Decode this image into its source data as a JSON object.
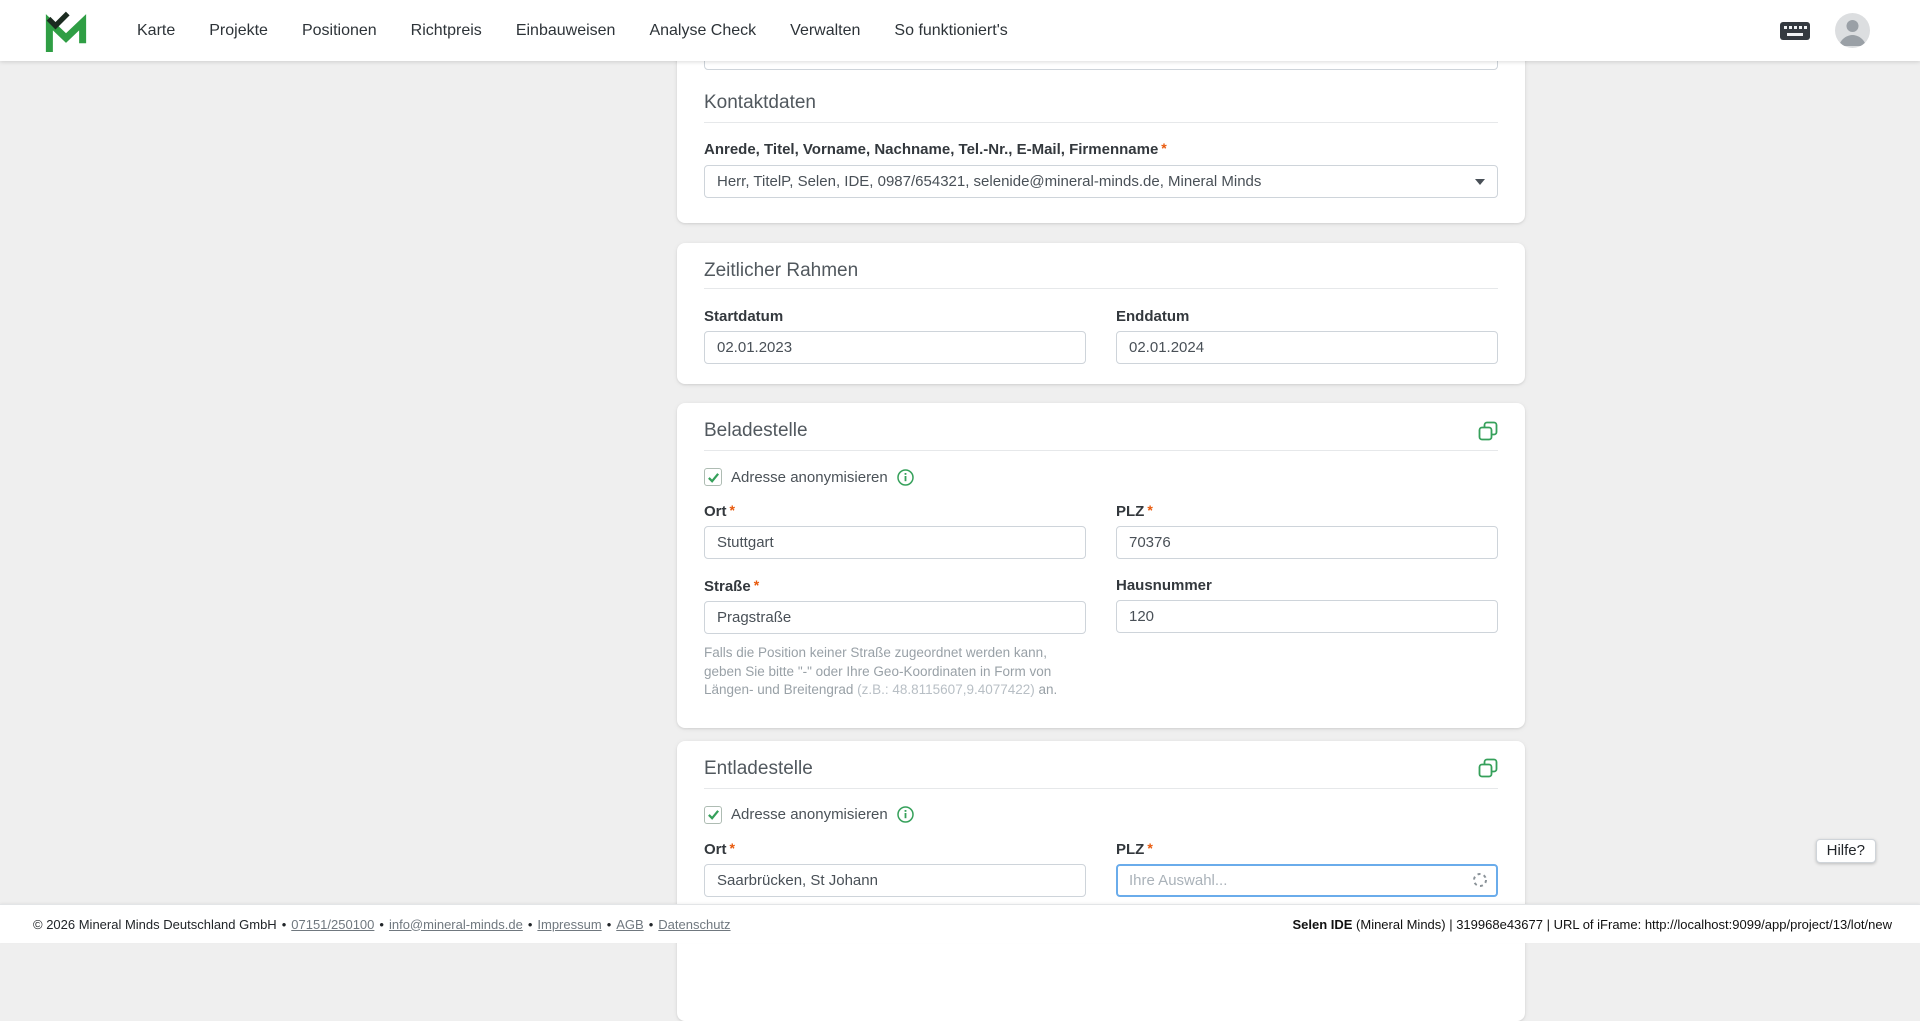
{
  "ui": {
    "required_mark": "*",
    "accent_color": "#35a05a"
  },
  "nav": {
    "items": [
      "Karte",
      "Projekte",
      "Positionen",
      "Richtpreis",
      "Einbauweisen",
      "Analyse Check",
      "Verwalten",
      "So funktioniert's"
    ]
  },
  "form": {
    "kontakt": {
      "title": "Kontaktdaten",
      "person_label": "Anrede, Titel, Vorname, Nachname, Tel.-Nr., E-Mail, Firmenname",
      "person_value": "Herr, TitelP, Selen, IDE, 0987/654321, selenide@mineral-minds.de, Mineral Minds"
    },
    "zeitraum": {
      "title": "Zeitlicher Rahmen",
      "start_label": "Startdatum",
      "start_value": "02.01.2023",
      "end_label": "Enddatum",
      "end_value": "02.01.2024"
    },
    "beladestelle": {
      "title": "Beladestelle",
      "anonymize_label": "Adresse anonymisieren",
      "ort_label": "Ort",
      "ort_value": "Stuttgart",
      "plz_label": "PLZ",
      "plz_value": "70376",
      "strasse_label": "Straße",
      "strasse_value": "Pragstraße",
      "hausnummer_label": "Hausnummer",
      "hausnummer_value": "120",
      "hint_text": "Falls die Position keiner Straße zugeordnet werden kann, geben Sie bitte \"-\" oder Ihre Geo-Koordinaten in Form von Längen- und Breitengrad ",
      "hint_example": "(z.B.: 48.8115607,9.4077422)",
      "hint_suffix": " an."
    },
    "entladestelle": {
      "title": "Entladestelle",
      "anonymize_label": "Adresse anonymisieren",
      "ort_label": "Ort",
      "ort_value": "Saarbrücken, St Johann",
      "plz_label": "PLZ",
      "plz_placeholder": "Ihre Auswahl..."
    }
  },
  "help": {
    "label": "Hilfe?"
  },
  "footer": {
    "copyright": "© 2026 Mineral Minds Deutschland GmbH",
    "separator": "•",
    "phone": "07151/250100",
    "email": "info@mineral-minds.de",
    "impressum": "Impressum",
    "agb": "AGB",
    "datenschutz": "Datenschutz",
    "session_user": "Selen IDE",
    "session_info": " (Mineral Minds) | 319968e43677 | URL of iFrame: http://localhost:9099/app/project/13/lot/new"
  }
}
